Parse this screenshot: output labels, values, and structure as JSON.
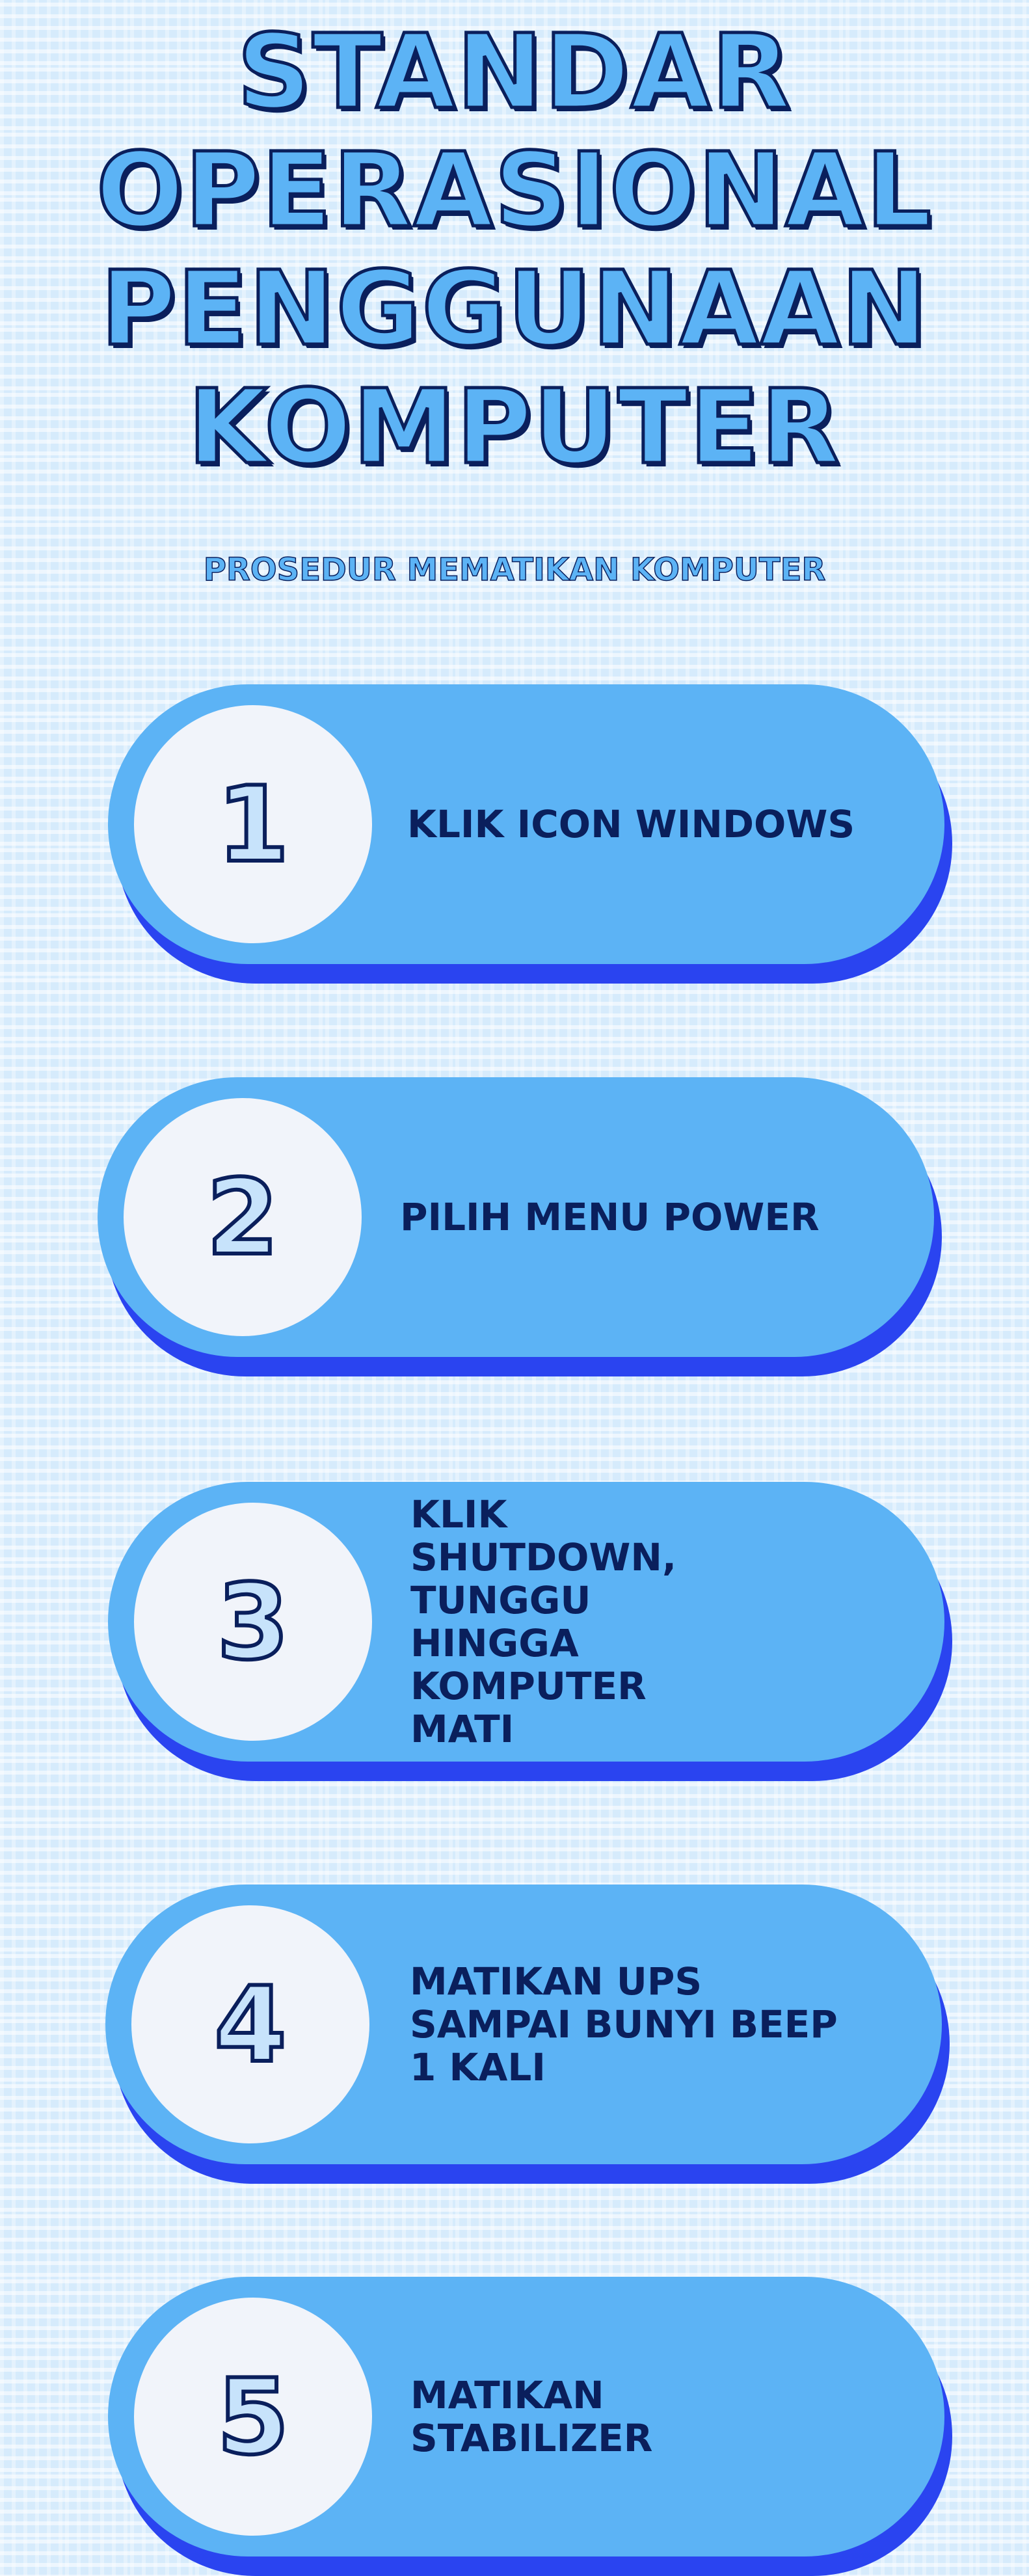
{
  "title": {
    "line1": "STANDAR",
    "line2": "OPERASIONAL",
    "line3": "PENGGUNAAN",
    "line4": "KOMPUTER"
  },
  "subtitle": "PROSEDUR MEMATIKAN KOMPUTER",
  "colors": {
    "background": "#d6ebfc",
    "pill": "#5cb3f5",
    "pill_shadow": "#2a44f0",
    "text_dark": "#0a1f5c",
    "circle": "#f1f4fa"
  },
  "steps": [
    {
      "number": "1",
      "label": "KLIK ICON WINDOWS"
    },
    {
      "number": "2",
      "label": "PILIH MENU POWER"
    },
    {
      "number": "3",
      "label": "KLIK SHUTDOWN, TUNGGU HINGGA KOMPUTER MATI"
    },
    {
      "number": "4",
      "label": "MATIKAN UPS SAMPAI BUNYI BEEP 1 KALI"
    },
    {
      "number": "5",
      "label": "MATIKAN STABILIZER"
    }
  ]
}
